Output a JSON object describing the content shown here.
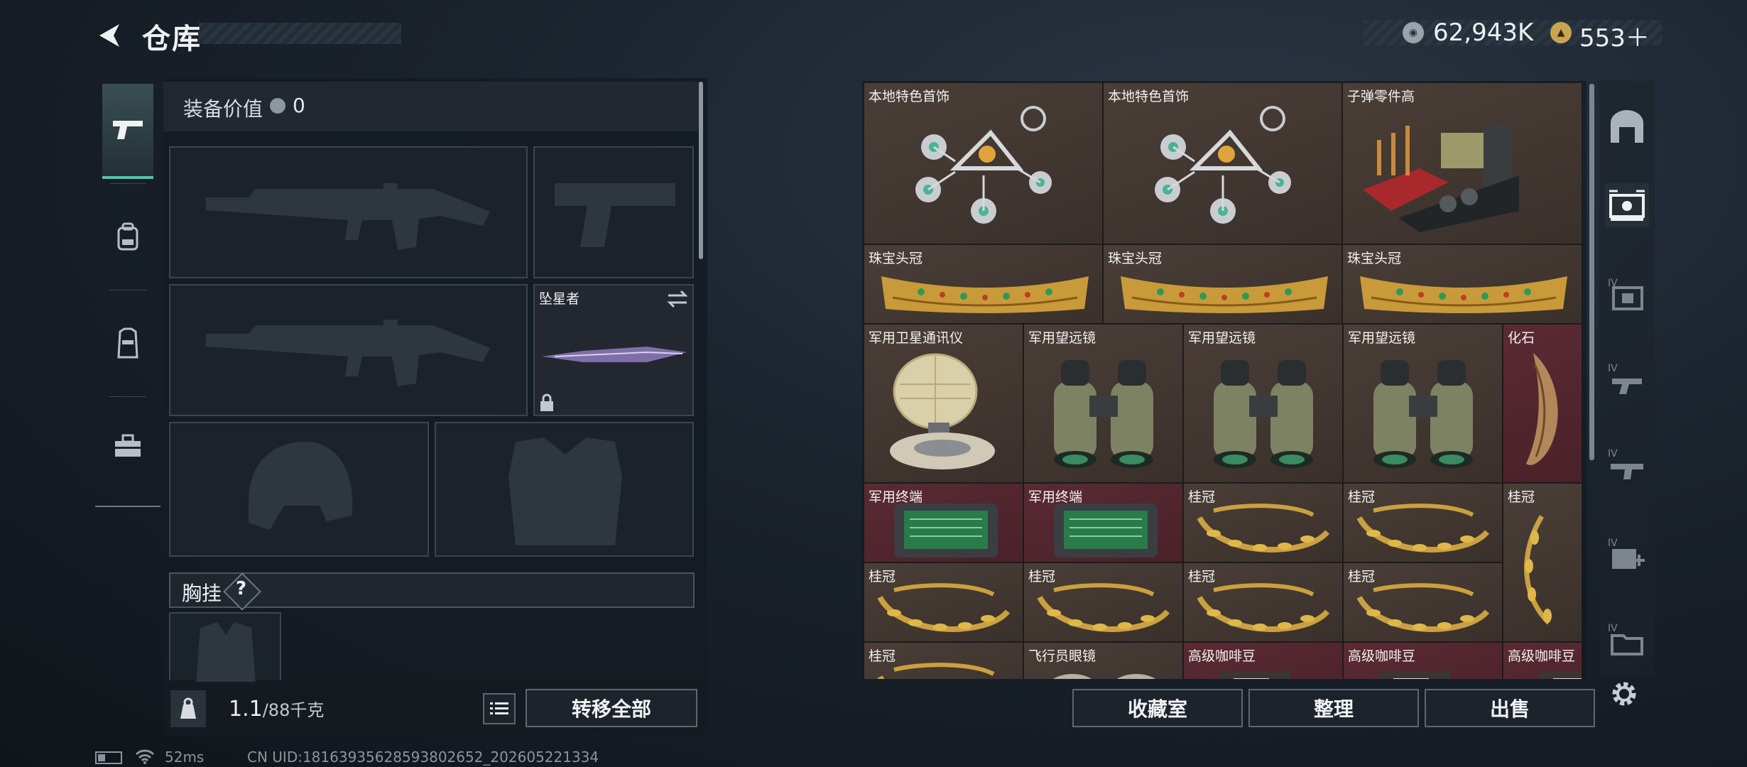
{
  "header": {
    "title": "仓库"
  },
  "currency": {
    "silver_amount": "62,943K",
    "gold_amount": "553＋"
  },
  "left_tabs": [
    {
      "name": "pistol-icon",
      "active": true
    },
    {
      "name": "backpack-icon",
      "active": false
    },
    {
      "name": "vest-icon",
      "active": false
    },
    {
      "name": "toolbox-icon",
      "active": false
    }
  ],
  "equipment": {
    "value_label": "装备价值",
    "value": "0",
    "melee_name": "坠星者",
    "rig_section_label": "胸挂",
    "rig_help": "?",
    "weight_current": "1.1",
    "weight_max": "/88千克",
    "transfer_all_label": "转移全部"
  },
  "storage_items": [
    {
      "name": "本地特色首饰",
      "bg": "brown"
    },
    {
      "name": "本地特色首饰",
      "bg": "brown"
    },
    {
      "name": "子弹零件高",
      "bg": "brown"
    },
    {
      "name": "珠宝头冠",
      "bg": "brown"
    },
    {
      "name": "珠宝头冠",
      "bg": "brown"
    },
    {
      "name": "珠宝头冠",
      "bg": "brown"
    },
    {
      "name": "军用卫星通讯仪",
      "bg": "brown"
    },
    {
      "name": "军用望远镜",
      "bg": "brown"
    },
    {
      "name": "军用望远镜",
      "bg": "brown"
    },
    {
      "name": "军用望远镜",
      "bg": "brown"
    },
    {
      "name": "化石",
      "bg": "red"
    },
    {
      "name": "军用终端",
      "bg": "red"
    },
    {
      "name": "军用终端",
      "bg": "red"
    },
    {
      "name": "桂冠",
      "bg": "brown"
    },
    {
      "name": "桂冠",
      "bg": "brown"
    },
    {
      "name": "桂冠",
      "bg": "brown"
    },
    {
      "name": "桂冠",
      "bg": "brown"
    },
    {
      "name": "桂冠",
      "bg": "brown"
    },
    {
      "name": "桂冠",
      "bg": "brown"
    },
    {
      "name": "桂冠",
      "bg": "brown"
    },
    {
      "name": "桂冠",
      "bg": "brown"
    },
    {
      "name": "飞行员眼镜",
      "bg": "brown"
    },
    {
      "name": "高级咖啡豆",
      "bg": "red"
    },
    {
      "name": "高级咖啡豆",
      "bg": "red"
    },
    {
      "name": "高级咖啡豆",
      "bg": "red"
    }
  ],
  "storage_buttons": {
    "collection": "收藏室",
    "organize": "整理",
    "sell": "出售"
  },
  "status_bar": {
    "ping": "52ms",
    "uid": "CN UID:18163935628593802652_202605221334"
  },
  "colors": {
    "accent": "#4fc6a3",
    "cell_brown": "#463a33",
    "cell_red": "#54262f"
  }
}
